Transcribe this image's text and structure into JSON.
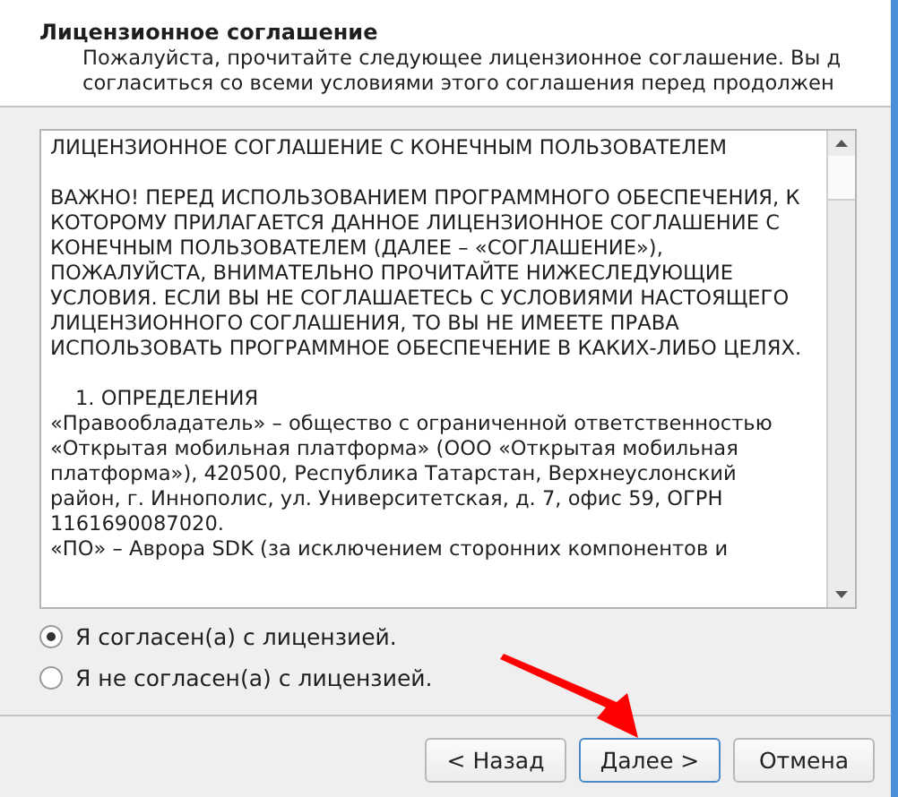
{
  "header": {
    "title": "Лицензионное соглашение",
    "description_lines": [
      "Пожалуйста, прочитайте следующее лицензионное соглашение. Вы д",
      "согласиться со всеми условиями этого соглашения перед продолжен"
    ]
  },
  "license_text": [
    {
      "kind": "plain",
      "text": "ЛИЦЕНЗИОННОЕ СОГЛАШЕНИЕ С КОНЕЧНЫМ ПОЛЬЗОВАТЕЛЕМ"
    },
    {
      "kind": "plain",
      "text": "ВАЖНО! ПЕРЕД ИСПОЛЬЗОВАНИЕМ ПРОГРАММНОГО ОБЕСПЕЧЕНИЯ, К КОТОРОМУ ПРИЛАГАЕТСЯ ДАННОЕ ЛИЦЕНЗИОННОЕ СОГЛАШЕНИЕ С КОНЕЧНЫМ ПОЛЬЗОВАТЕЛЕМ (ДАЛЕЕ – «СОГЛАШЕНИЕ»), ПОЖАЛУЙСТА, ВНИМАТЕЛЬНО ПРОЧИТАЙТЕ НИЖЕСЛЕДУЮЩИЕ УСЛОВИЯ. ЕСЛИ ВЫ НЕ СОГЛАШАЕТЕСЬ С УСЛОВИЯМИ НАСТОЯЩЕГО ЛИЦЕНЗИОННОГО СОГЛАШЕНИЯ, ТО ВЫ НЕ ИМЕЕТЕ ПРАВА ИСПОЛЬЗОВАТЬ ПРОГРАММНОЕ ОБЕСПЕЧЕНИЕ В КАКИХ-ЛИБО ЦЕЛЯХ."
    },
    {
      "kind": "heading",
      "text": "1. ОПРЕДЕЛЕНИЯ"
    },
    {
      "kind": "continued",
      "text": "«Правообладатель» – общество с ограниченной ответственностью «Открытая мобильная платформа» (ООО «Открытая мобильная платформа»), 420500, Республика Татарстан, Верхнеуслонский район, г. Иннополис, ул. Университетская, д. 7, офис 59, ОГРН 1161690087020."
    },
    {
      "kind": "continued",
      "text": "«ПО» – Аврора SDK (за исключением сторонних компонентов и"
    }
  ],
  "options": [
    {
      "label": "Я согласен(а) с лицензией.",
      "selected": true
    },
    {
      "label": "Я не согласен(а) с лицензией.",
      "selected": false
    }
  ],
  "buttons": [
    {
      "label": "< Назад",
      "focused": false
    },
    {
      "label": "Далее >",
      "focused": true
    },
    {
      "label": "Отмена",
      "focused": false
    }
  ]
}
